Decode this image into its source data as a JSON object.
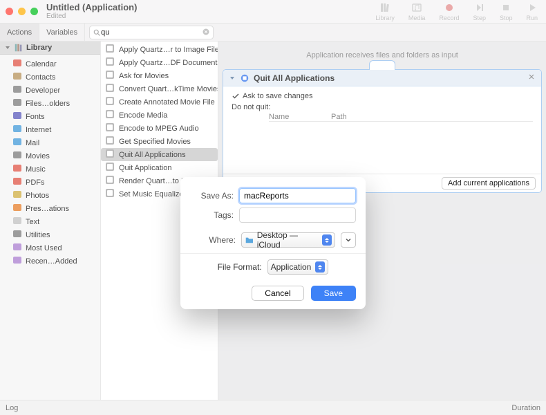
{
  "window": {
    "title": "Untitled (Application)",
    "subtitle": "Edited"
  },
  "toolbar_buttons": [
    {
      "name": "library",
      "label": "Library"
    },
    {
      "name": "media",
      "label": "Media"
    },
    {
      "name": "record",
      "label": "Record"
    },
    {
      "name": "step",
      "label": "Step"
    },
    {
      "name": "stop",
      "label": "Stop"
    },
    {
      "name": "run",
      "label": "Run"
    }
  ],
  "tabs": {
    "actions": "Actions",
    "variables": "Variables"
  },
  "search": {
    "query": "qu"
  },
  "library": {
    "header": "Library",
    "items": [
      {
        "label": "Calendar",
        "color": "#e46a5e"
      },
      {
        "label": "Contacts",
        "color": "#bfa06f"
      },
      {
        "label": "Developer",
        "color": "#8c8c8c"
      },
      {
        "label": "Files…olders",
        "color": "#8c8c8c"
      },
      {
        "label": "Fonts",
        "color": "#6f6fc4"
      },
      {
        "label": "Internet",
        "color": "#5aa7de"
      },
      {
        "label": "Mail",
        "color": "#5aa7de"
      },
      {
        "label": "Movies",
        "color": "#8c8c8c"
      },
      {
        "label": "Music",
        "color": "#e46a5e"
      },
      {
        "label": "PDFs",
        "color": "#e46a5e"
      },
      {
        "label": "Photos",
        "color": "#d6b95a"
      },
      {
        "label": "Pres…ations",
        "color": "#e98f45"
      },
      {
        "label": "Text",
        "color": "#c9c9c9"
      },
      {
        "label": "Utilities",
        "color": "#8c8c8c"
      },
      {
        "label": "Most Used",
        "color": "#b58fd6"
      },
      {
        "label": "Recen…Added",
        "color": "#b58fd6"
      }
    ]
  },
  "actions": [
    {
      "label": "Apply Quartz…r to Image Files",
      "sel": false
    },
    {
      "label": "Apply Quartz…DF Documents",
      "sel": false
    },
    {
      "label": "Ask for Movies",
      "sel": false
    },
    {
      "label": "Convert Quart…kTime Movies",
      "sel": false
    },
    {
      "label": "Create Annotated Movie File",
      "sel": false
    },
    {
      "label": "Encode Media",
      "sel": false
    },
    {
      "label": "Encode to MPEG Audio",
      "sel": false
    },
    {
      "label": "Get Specified Movies",
      "sel": false
    },
    {
      "label": "Quit All Applications",
      "sel": true
    },
    {
      "label": "Quit Application",
      "sel": false
    },
    {
      "label": "Render Quart…to Image Files",
      "sel": false
    },
    {
      "label": "Set Music Equalizer",
      "sel": false
    }
  ],
  "workflow": {
    "hint": "Application receives files and folders as input",
    "action_title": "Quit All Applications",
    "ask_to_save": "Ask to save changes",
    "do_not_quit": "Do not quit:",
    "col_name": "Name",
    "col_path": "Path",
    "add_btn": "Add current applications"
  },
  "logbar": {
    "log": "Log",
    "duration": "Duration"
  },
  "sheet": {
    "save_as_label": "Save As:",
    "save_as_value": "macReports",
    "tags_label": "Tags:",
    "where_label": "Where:",
    "where_value": "Desktop — iCloud",
    "file_format_label": "File Format:",
    "file_format_value": "Application",
    "cancel": "Cancel",
    "save": "Save"
  }
}
